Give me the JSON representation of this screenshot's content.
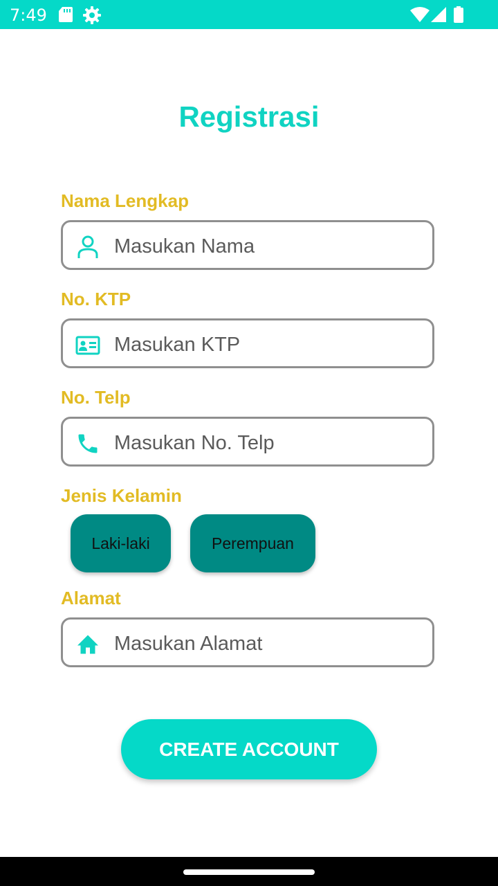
{
  "status_bar": {
    "time": "7:49",
    "icons": [
      "sd-card-icon",
      "settings-gear-icon",
      "wifi-icon",
      "signal-icon",
      "battery-icon"
    ]
  },
  "page": {
    "title": "Registrasi"
  },
  "form": {
    "nama": {
      "label": "Nama Lengkap",
      "placeholder": "Masukan Nama",
      "icon": "person-icon"
    },
    "ktp": {
      "label": "No. KTP",
      "placeholder": "Masukan KTP",
      "icon": "id-card-icon"
    },
    "telp": {
      "label": "No. Telp",
      "placeholder": "Masukan No. Telp",
      "icon": "phone-icon"
    },
    "gender": {
      "label": "Jenis Kelamin",
      "options": [
        "Laki-laki",
        "Perempuan"
      ]
    },
    "alamat": {
      "label": "Alamat",
      "placeholder": "Masukan Alamat",
      "icon": "home-icon"
    }
  },
  "actions": {
    "create_label": "CREATE ACCOUNT"
  },
  "colors": {
    "accent": "#05d9c8",
    "title": "#10d3c2",
    "label": "#e2bb24",
    "gender_button": "#008a84",
    "field_border": "#8f8f8f"
  }
}
